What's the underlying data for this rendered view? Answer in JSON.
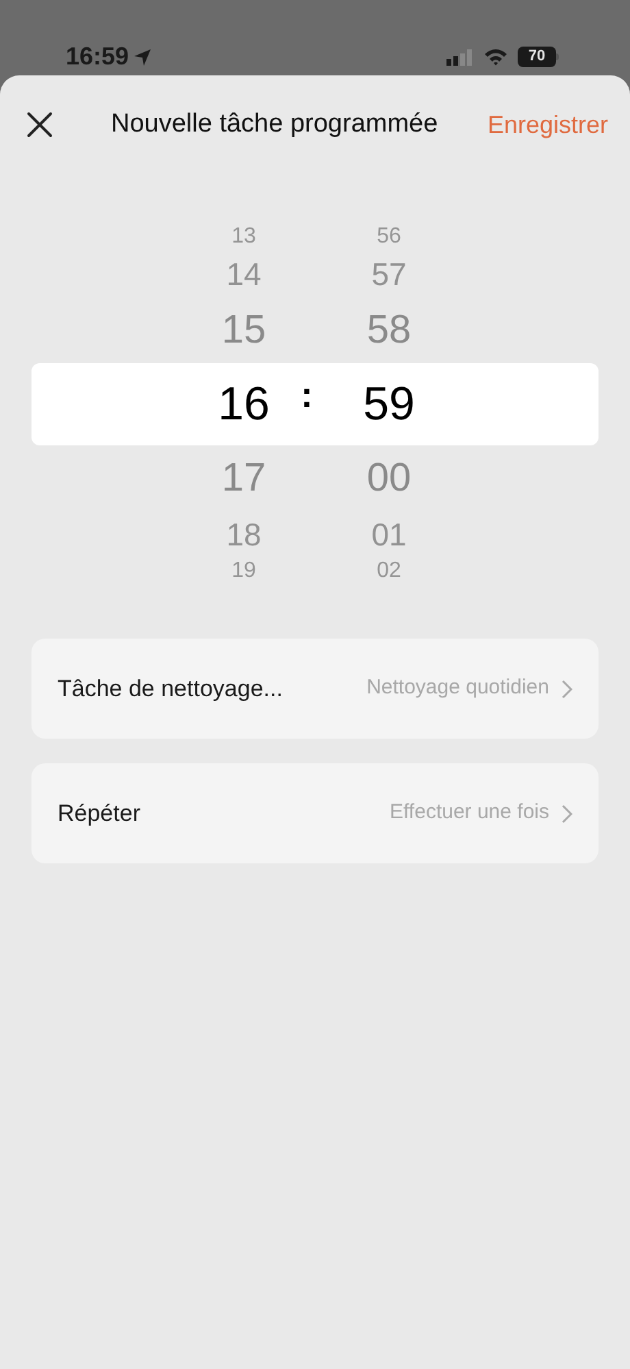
{
  "status_bar": {
    "time": "16:59",
    "battery": "70"
  },
  "header": {
    "title": "Nouvelle tâche programmée",
    "save": "Enregistrer"
  },
  "picker": {
    "separator": ":",
    "hours": [
      {
        "value": "13",
        "selected": false
      },
      {
        "value": "14",
        "selected": false
      },
      {
        "value": "15",
        "selected": false
      },
      {
        "value": "16",
        "selected": true
      },
      {
        "value": "17",
        "selected": false
      },
      {
        "value": "18",
        "selected": false
      },
      {
        "value": "19",
        "selected": false
      }
    ],
    "minutes": [
      {
        "value": "56",
        "selected": false
      },
      {
        "value": "57",
        "selected": false
      },
      {
        "value": "58",
        "selected": false
      },
      {
        "value": "59",
        "selected": true
      },
      {
        "value": "00",
        "selected": false
      },
      {
        "value": "01",
        "selected": false
      },
      {
        "value": "02",
        "selected": false
      }
    ]
  },
  "settings": [
    {
      "label": "Tâche de nettoyage...",
      "value": "Nettoyage quotidien"
    },
    {
      "label": "Répéter",
      "value": "Effectuer une fois"
    }
  ]
}
